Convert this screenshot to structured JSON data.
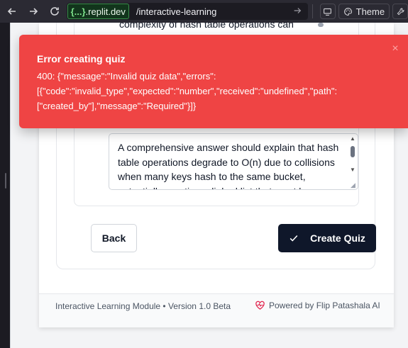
{
  "browser": {
    "domain_prefix": "{...}",
    "domain_suffix": ".replit.dev",
    "path": "/interactive-learning",
    "theme_label": "Theme"
  },
  "page": {
    "question_snippet": "complexity of hash table operations can",
    "answer_text": "A comprehensive answer should explain that hash table operations degrade to O(n) due to collisions when many keys hash to the same bucket, potentially creating a linked list that must be traversed.",
    "back_label": "Back",
    "create_label": "Create Quiz",
    "footer_left": "Interactive Learning Module • Version 1.0 Beta",
    "footer_right": "Powered by Flip Patashala AI"
  },
  "toast": {
    "title": "Error creating quiz",
    "message": "400: {\"message\":\"Invalid quiz data\",\"errors\":[{\"code\":\"invalid_type\",\"expected\":\"number\",\"received\":\"undefined\",\"path\":[\"created_by\"],\"message\":\"Required\"}]}",
    "close_glyph": "×",
    "color": "#ef4444"
  }
}
